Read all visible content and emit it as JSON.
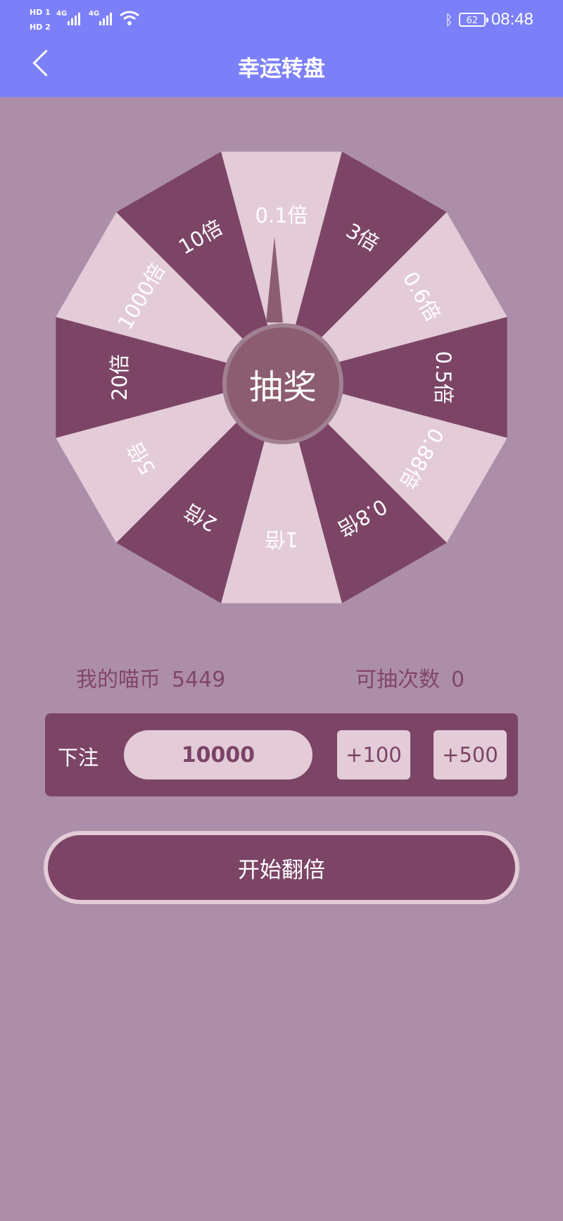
{
  "statusbar": {
    "hd1": "HD 1",
    "hd2": "HD 2",
    "net1": "4G",
    "net2": "4G",
    "bluetooth_icon": "bluetooth-icon",
    "battery": "62",
    "time": "08:48"
  },
  "header": {
    "title": "幸运转盘"
  },
  "wheel": {
    "segments": [
      "0.1倍",
      "3倍",
      "0.6倍",
      "0.5倍",
      "0.88倍",
      "0.8倍",
      "1倍",
      "2倍",
      "5倍",
      "20倍",
      "1000倍",
      "10倍"
    ],
    "colors": {
      "light": "#e3cbd7",
      "dark": "#7c4566",
      "light_text": "#ffffff",
      "dark_text": "#ffffff"
    },
    "center_label": "抽奖"
  },
  "stats": {
    "coins_label": "我的喵币",
    "coins_value": "5449",
    "draws_label": "可抽次数",
    "draws_value": "0"
  },
  "bet": {
    "label": "下注",
    "value": "10000",
    "add100": "+100",
    "add500": "+500"
  },
  "start_button": "开始翻倍"
}
